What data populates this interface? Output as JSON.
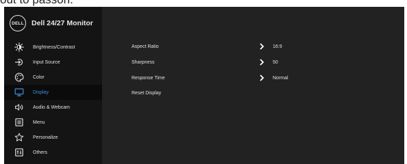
{
  "top_text": "out to passon.",
  "brand": {
    "logo_text": "DELL",
    "model": "Dell 24/27 Monitor"
  },
  "sidebar": {
    "items": [
      {
        "label": "Brightness/Contrast",
        "icon": "brightness-icon"
      },
      {
        "label": "Input Source",
        "icon": "input-source-icon"
      },
      {
        "label": "Color",
        "icon": "palette-icon"
      },
      {
        "label": "Display",
        "icon": "monitor-icon",
        "active": true
      },
      {
        "label": "Audio & Webcam",
        "icon": "speaker-icon"
      },
      {
        "label": "Menu",
        "icon": "menu-icon"
      },
      {
        "label": "Personalize",
        "icon": "star-icon"
      },
      {
        "label": "Others",
        "icon": "others-icon"
      }
    ]
  },
  "display_panel": {
    "rows": [
      {
        "label": "Aspect Ratio",
        "value": "16:9",
        "has_submenu": true
      },
      {
        "label": "Sharpness",
        "value": "50",
        "has_submenu": true
      },
      {
        "label": "Response Time",
        "value": "Normal",
        "has_submenu": true
      },
      {
        "label": "Reset Display",
        "value": "",
        "has_submenu": false
      }
    ]
  },
  "colors": {
    "osd_background": "#222222",
    "sidebar_background": "#141414",
    "active_accent": "#3f8fe0",
    "text": "#e2e2e2"
  }
}
